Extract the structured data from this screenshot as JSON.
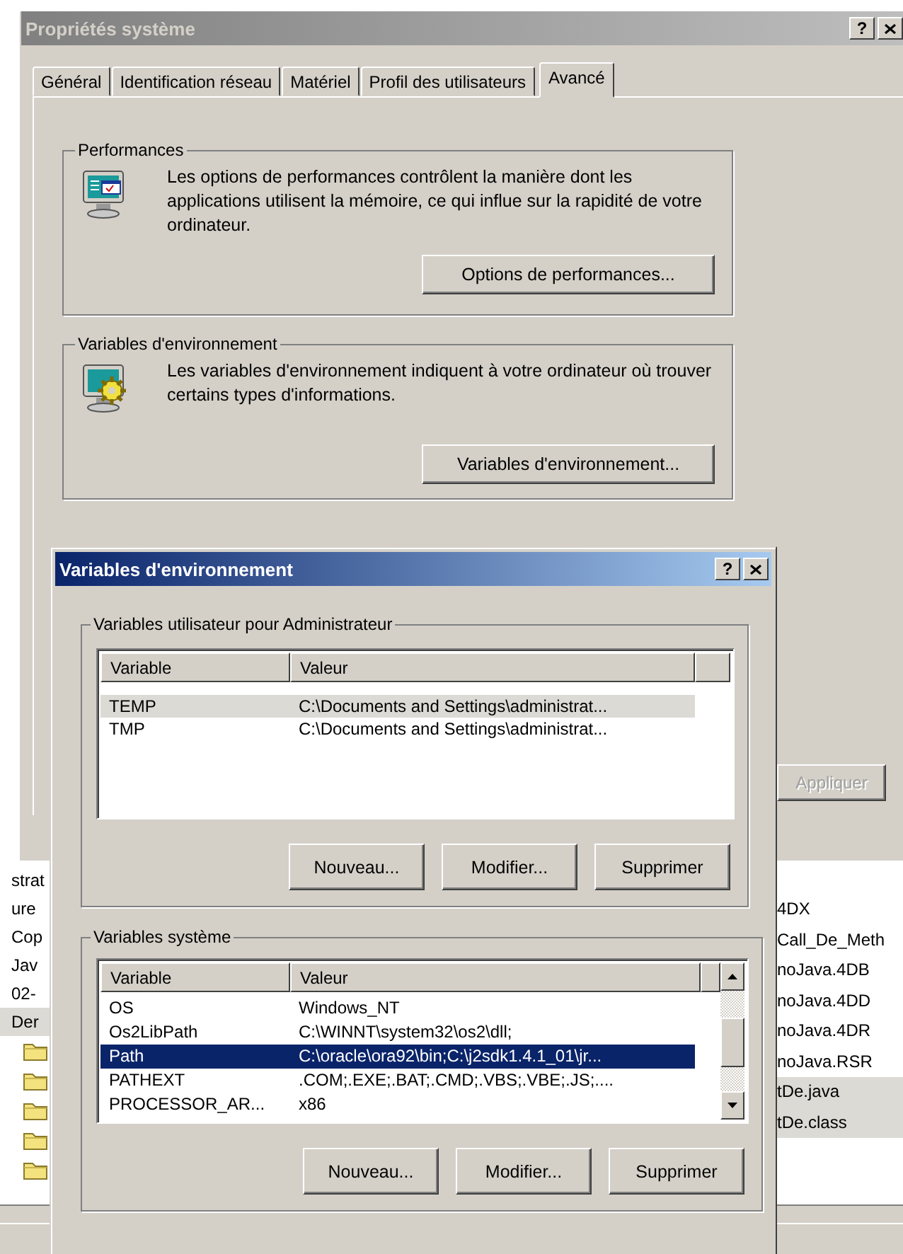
{
  "desktop_window": {
    "left_items": [
      {
        "kind": "text",
        "label": "strat",
        "selected": false
      },
      {
        "kind": "text",
        "label": "ure",
        "selected": false
      },
      {
        "kind": "text",
        "label": "Cop",
        "selected": false
      },
      {
        "kind": "text",
        "label": "Jav",
        "selected": false
      },
      {
        "kind": "text",
        "label": "02-",
        "selected": false
      },
      {
        "kind": "text",
        "label": "Der",
        "selected": true
      },
      {
        "kind": "folder",
        "selected": false
      },
      {
        "kind": "folder",
        "selected": false
      },
      {
        "kind": "folder",
        "selected": false
      },
      {
        "kind": "folder",
        "selected": false
      },
      {
        "kind": "folder",
        "selected": false
      }
    ],
    "right_items": [
      {
        "label": "4DX",
        "selected": false
      },
      {
        "label": "Call_De_Meth",
        "selected": false
      },
      {
        "label": "noJava.4DB",
        "selected": false
      },
      {
        "label": "noJava.4DD",
        "selected": false
      },
      {
        "label": "noJava.4DR",
        "selected": false
      },
      {
        "label": "noJava.RSR",
        "selected": false
      },
      {
        "label": "tDe.java",
        "selected": true
      },
      {
        "label": "tDe.class",
        "selected": true
      }
    ]
  },
  "properties_window": {
    "title": "Propriétés système",
    "active": false,
    "help_button": "?",
    "tabs": [
      {
        "label": "Général",
        "selected": false
      },
      {
        "label": "Identification réseau",
        "selected": false
      },
      {
        "label": "Matériel",
        "selected": false
      },
      {
        "label": "Profil des utilisateurs",
        "selected": false
      },
      {
        "label": "Avancé",
        "selected": true
      }
    ],
    "groups": [
      {
        "kind": "performance",
        "title": "Performances",
        "description": "Les options de performances contrôlent la manière dont les applications utilisent la mémoire, ce qui influe sur la rapidité de votre ordinateur.",
        "button": "Options de performances..."
      },
      {
        "kind": "environment",
        "title": "Variables d'environnement",
        "description": "Les variables d'environnement indiquent à votre ordinateur où trouver certains types d'informations.",
        "button": "Variables d'environnement..."
      }
    ],
    "apply_button": {
      "label": "Appliquer",
      "disabled": true
    }
  },
  "env_dialog": {
    "title": "Variables d'environnement",
    "active": true,
    "help_button": "?",
    "groups": [
      {
        "kind": "plain",
        "title": "Variables utilisateur pour Administrateur",
        "focused": false,
        "columns": [
          "Variable",
          "Valeur"
        ],
        "rows": [
          {
            "variable": "TEMP",
            "value": "C:\\Documents and Settings\\administrat...",
            "selected": true
          },
          {
            "variable": "TMP",
            "value": "C:\\Documents and Settings\\administrat...",
            "selected": false
          }
        ],
        "buttons": [
          "Nouveau...",
          "Modifier...",
          "Supprimer"
        ]
      },
      {
        "kind": "scrollable",
        "title": "Variables système",
        "focused": true,
        "columns": [
          "Variable",
          "Valeur"
        ],
        "rows": [
          {
            "variable": "OS",
            "value": "Windows_NT",
            "selected": false
          },
          {
            "variable": "Os2LibPath",
            "value": "C:\\WINNT\\system32\\os2\\dll;",
            "selected": false
          },
          {
            "variable": "Path",
            "value": "C:\\oracle\\ora92\\bin;C:\\j2sdk1.4.1_01\\jr...",
            "selected": true
          },
          {
            "variable": "PATHEXT",
            "value": ".COM;.EXE;.BAT;.CMD;.VBS;.VBE;.JS;....",
            "selected": false
          },
          {
            "variable": "PROCESSOR_AR...",
            "value": "x86",
            "selected": false
          }
        ],
        "buttons": [
          "Nouveau...",
          "Modifier...",
          "Supprimer"
        ]
      }
    ]
  }
}
